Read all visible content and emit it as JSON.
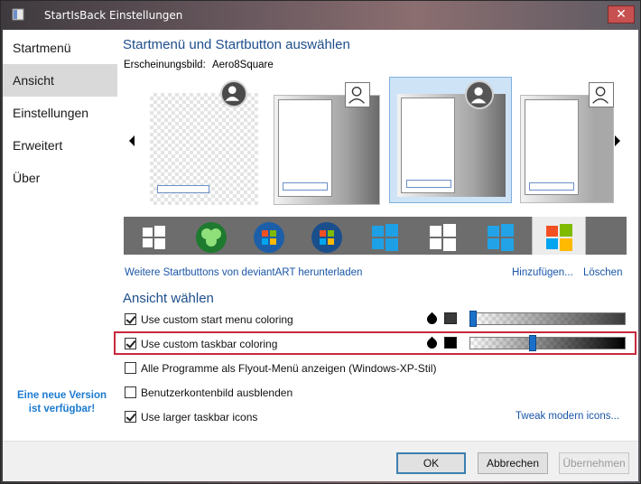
{
  "window": {
    "title": "StartIsBack Einstellungen",
    "close_label": "✕"
  },
  "sidebar": {
    "items": [
      {
        "label": "Startmenü",
        "selected": false
      },
      {
        "label": "Ansicht",
        "selected": true
      },
      {
        "label": "Einstellungen",
        "selected": false
      },
      {
        "label": "Erweitert",
        "selected": false
      },
      {
        "label": "Über",
        "selected": false
      }
    ],
    "update_notice": "Eine neue Version ist verfügbar!"
  },
  "main": {
    "heading": "Startmenü und Startbutton auswählen",
    "appearance_label": "Erscheinungsbild:",
    "appearance_value": "Aero8Square",
    "more_buttons_link": "Weitere Startbuttons von deviantART herunterladen",
    "add_link": "Hinzufügen...",
    "delete_link": "Löschen",
    "view_heading": "Ansicht wählen",
    "options": [
      {
        "label": "Use custom start menu coloring",
        "checked": true,
        "slider": 0.0
      },
      {
        "label": "Use custom taskbar coloring",
        "checked": true,
        "slider": 0.4
      },
      {
        "label": "Alle Programme als Flyout-Menü anzeigen (Windows-XP-Stil)",
        "checked": false
      },
      {
        "label": "Benutzerkontenbild ausblenden",
        "checked": false
      },
      {
        "label": "Use larger taskbar icons",
        "checked": true
      }
    ],
    "tweak_link": "Tweak modern icons..."
  },
  "footer": {
    "ok": "OK",
    "cancel": "Abbrechen",
    "apply": "Übernehmen"
  },
  "colors": {
    "accent": "#1e4e8c",
    "link": "#1a56a8",
    "highlight": "#c8283c",
    "selection": "#d9d9d9"
  }
}
